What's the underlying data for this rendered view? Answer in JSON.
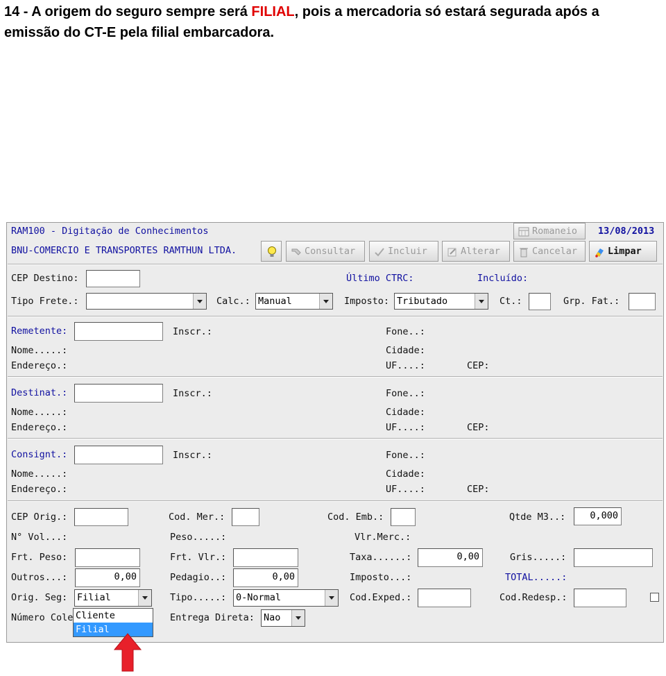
{
  "caption": {
    "line1_prefix": "14 - A origem do seguro sempre será ",
    "line1_highlight": "FILIAL",
    "line1_suffix": ", pois a mercadoria só estará segurada após a",
    "line2": "emissão do CT-E pela filial embarcadora."
  },
  "window": {
    "title": "RAM100 - Digitação de Conhecimentos",
    "company": "BNU-COMERCIO E TRANSPORTES RAMTHUN LTDA.",
    "date": "13/08/2013"
  },
  "toolbar": {
    "romaneio": "Romaneio",
    "consultar": "Consultar",
    "incluir": "Incluir",
    "alterar": "Alterar",
    "cancelar": "Cancelar",
    "limpar": "Limpar"
  },
  "header": {
    "cep_destino": "CEP Destino:",
    "ultimo_ctrc": "Último CTRC:",
    "incluido": "Incluído:",
    "tipo_frete": "Tipo Frete.:",
    "tipo_frete_value": "",
    "calc": "Calc.:",
    "calc_value": "Manual",
    "imposto": "Imposto:",
    "imposto_value": "Tributado",
    "ct": "Ct.:",
    "grp_fat": "Grp. Fat.:"
  },
  "remetente": {
    "label": "Remetente:",
    "inscr": "Inscr.:",
    "fone": "Fone..:",
    "nome": "Nome.....:",
    "cidade": "Cidade:",
    "endereco": "Endereço.:",
    "uf": "UF....:",
    "cep": "CEP:"
  },
  "destinat": {
    "label": "Destinat.:",
    "inscr": "Inscr.:",
    "fone": "Fone..:",
    "nome": "Nome.....:",
    "cidade": "Cidade:",
    "endereco": "Endereço.:",
    "uf": "UF....:",
    "cep": "CEP:"
  },
  "consigt": {
    "label": "Consignt.:",
    "inscr": "Inscr.:",
    "fone": "Fone..:",
    "nome": "Nome.....:",
    "cidade": "Cidade:",
    "endereco": "Endereço.:",
    "uf": "UF....:",
    "cep": "CEP:"
  },
  "cargo": {
    "cep_orig": "CEP Orig.:",
    "cod_mer": "Cod. Mer.:",
    "cod_emb": "Cod. Emb.:",
    "qtde_m3": "Qtde M3..:",
    "qtde_m3_value": "0,000",
    "n_vol": "N° Vol...:",
    "peso": "Peso.....:",
    "vlr_merc": "Vlr.Merc.:",
    "frt_peso": "Frt. Peso:",
    "frt_vlr": "Frt. Vlr.:",
    "taxa": "Taxa......:",
    "taxa_value": "0,00",
    "gris": "Gris.....:",
    "outros": "Outros...:",
    "outros_value": "0,00",
    "pedagio": "Pedagio..:",
    "pedagio_value": "0,00",
    "imposto": "Imposto...:",
    "total": "TOTAL.....:",
    "orig_seg": "Orig. Seg:",
    "orig_seg_value": "Filial",
    "tipo": "Tipo.....:",
    "tipo_value": "0-Normal",
    "cod_exped": "Cod.Exped.:",
    "cod_redesp": "Cod.Redesp.:",
    "numero_cole": "Número Cole",
    "entrega_direta": "Entrega Direta:",
    "entrega_direta_value": "Nao"
  },
  "orig_seg_options": [
    "Cliente",
    "Filial"
  ],
  "colors": {
    "highlight": "#e00000",
    "label_blue": "#1010a0",
    "selection": "#3399ff",
    "arrow": "#e8202a"
  }
}
